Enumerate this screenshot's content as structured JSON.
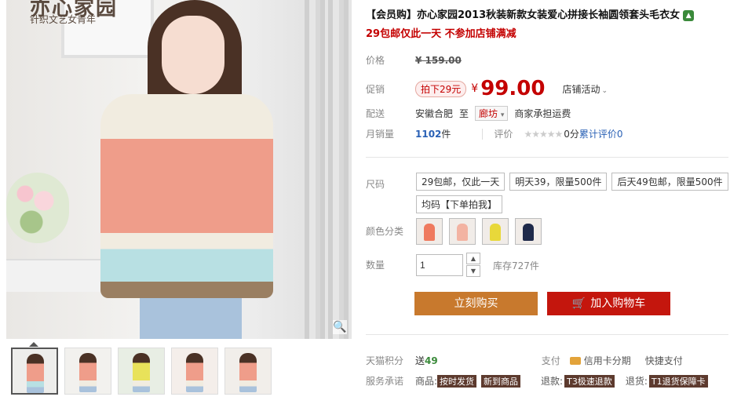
{
  "brand": {
    "name": "亦心家园",
    "tagline": "针织文艺女青年"
  },
  "product": {
    "title": "【会员购】亦心家园2013秋装新款女装爱心拼接长袖圆领套头毛衣女",
    "promo_line": "29包邮仅此一天 不参加店铺满减"
  },
  "price": {
    "label": "价格",
    "original": "¥ 159.00"
  },
  "promo": {
    "label": "促销",
    "badge": "拍下29元",
    "currency": "¥",
    "amount": "99.00",
    "store_activity": "店铺活动"
  },
  "shipping": {
    "label": "配送",
    "from": "安徽合肥",
    "to_word": "至",
    "dest": "廊坊",
    "fee": "商家承担运费"
  },
  "sales": {
    "label": "月销量",
    "count": "1102",
    "unit": "件",
    "rating_label": "评价",
    "rating_text": "0分",
    "review_text": "累计评价0"
  },
  "size": {
    "label": "尺码",
    "options": [
      "29包邮，仅此一天",
      "明天39，限量500件",
      "后天49包邮，限量500件",
      "均码【下单拍我】"
    ]
  },
  "color": {
    "label": "颜色分类"
  },
  "quantity": {
    "label": "数量",
    "value": "1",
    "stock": "库存727件"
  },
  "actions": {
    "buy": "立刻购买",
    "cart": "加入购物车"
  },
  "points": {
    "label": "天猫积分",
    "prefix": "送",
    "value": "49",
    "pay_label": "支付",
    "credit": "信用卡分期",
    "quick": "快捷支付"
  },
  "service": {
    "label": "服务承诺",
    "goods_prefix": "商品:",
    "tag1": "按时发货",
    "tag2": "新到商品",
    "ret_prefix": "退款:",
    "tag3": "T3极速退款",
    "ret2_prefix": "退货:",
    "tag4": "T1退货保障卡"
  },
  "colors": {
    "price_red": "#c40000",
    "buy": "#c8792d",
    "cart": "#c4160d"
  }
}
